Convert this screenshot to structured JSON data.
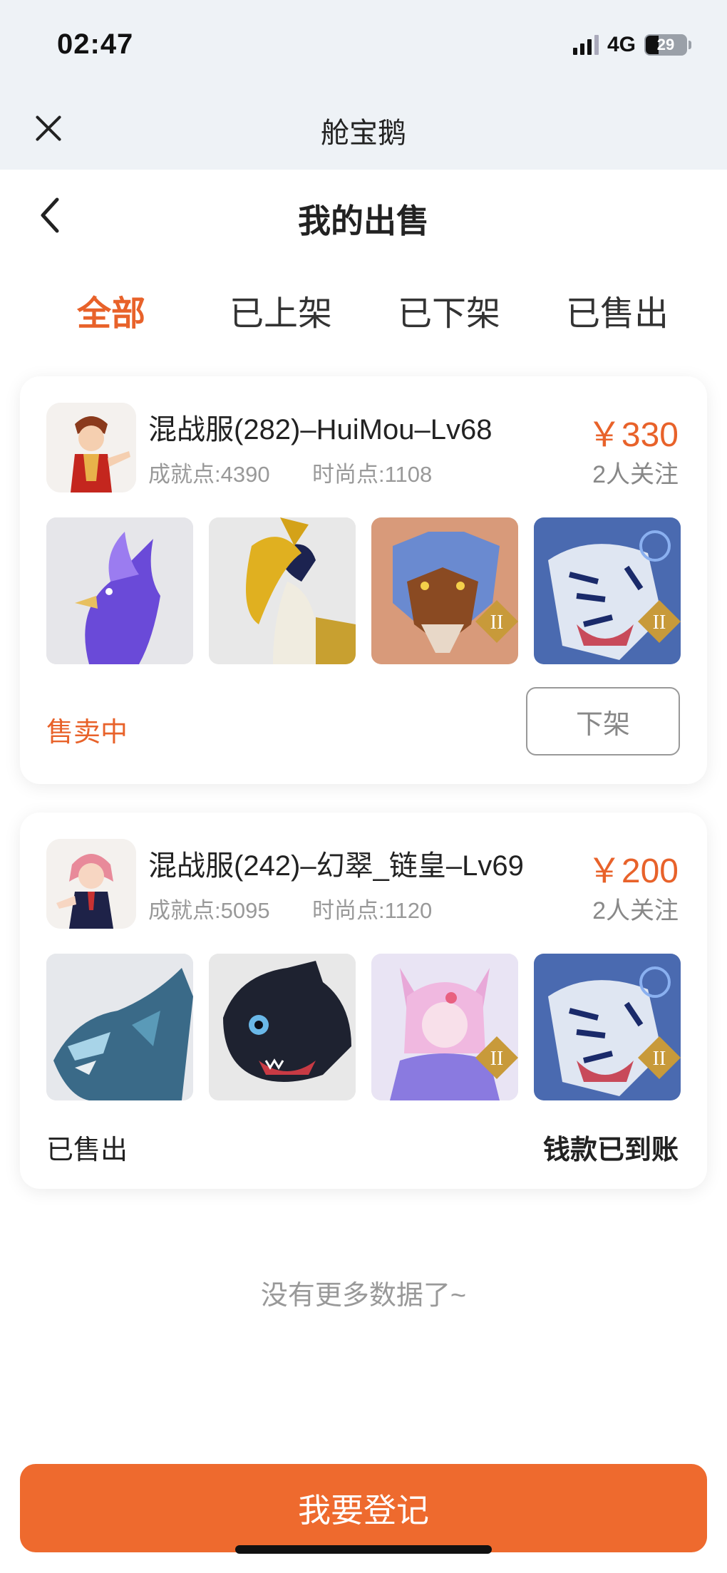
{
  "status_bar": {
    "time": "02:47",
    "network": "4G",
    "battery": "29"
  },
  "app": {
    "title": "舱宝鹅"
  },
  "page": {
    "title": "我的出售"
  },
  "tabs": [
    {
      "label": "全部",
      "active": true
    },
    {
      "label": "已上架",
      "active": false
    },
    {
      "label": "已下架",
      "active": false
    },
    {
      "label": "已售出",
      "active": false
    }
  ],
  "listings": [
    {
      "title": "混战服(282)–HuiMou–Lv68",
      "achievement": "成就点:4390",
      "fashion": "时尚点:1108",
      "price": "￥330",
      "followers": "2人关注",
      "status": "售卖中",
      "action": "下架",
      "pets": [
        "phoenix-pet-icon",
        "hornbill-pet-icon",
        "wolf-pet-icon",
        "tiger-pet-icon"
      ]
    },
    {
      "title": "混战服(242)–幻翠_链皇–Lv69",
      "achievement": "成就点:5095",
      "fashion": "时尚点:1120",
      "price": "￥200",
      "followers": "2人关注",
      "status": "已售出",
      "note": "钱款已到账",
      "pets": [
        "dragon-pet-icon",
        "black-beast-pet-icon",
        "fox-girl-pet-icon",
        "tiger-pet-icon"
      ]
    }
  ],
  "footer": {
    "no_more": "没有更多数据了~",
    "register_button": "我要登记"
  },
  "colors": {
    "accent": "#e8622a",
    "button": "#ee6a2e"
  }
}
